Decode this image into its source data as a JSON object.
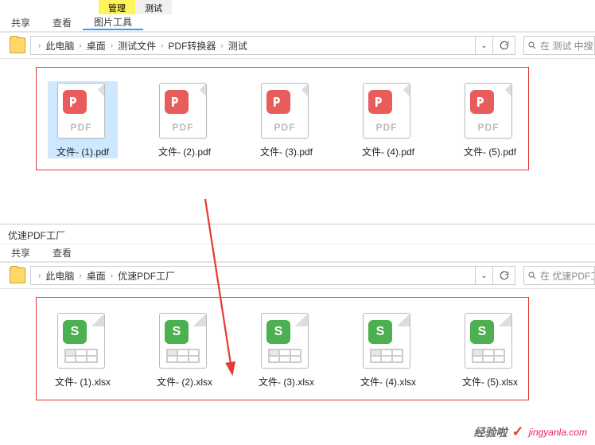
{
  "top": {
    "ribbon_label": "管理",
    "ribbon_context": "测试",
    "tabs": {
      "share": "共享",
      "view": "查看",
      "image_tools": "图片工具"
    },
    "breadcrumb": [
      "此电脑",
      "桌面",
      "测试文件",
      "PDF转换器",
      "测试"
    ],
    "search_placeholder": "在 测试 中搜",
    "files": [
      {
        "name": "文件- (1).pdf",
        "type": "pdf"
      },
      {
        "name": "文件- (2).pdf",
        "type": "pdf"
      },
      {
        "name": "文件- (3).pdf",
        "type": "pdf"
      },
      {
        "name": "文件- (4).pdf",
        "type": "pdf"
      },
      {
        "name": "文件- (5).pdf",
        "type": "pdf"
      }
    ],
    "pdf_label": "PDF"
  },
  "bottom": {
    "title": "优速PDF工厂",
    "tabs": {
      "share": "共享",
      "view": "查看"
    },
    "breadcrumb": [
      "此电脑",
      "桌面",
      "优速PDF工厂"
    ],
    "search_placeholder": "在 优速PDF工",
    "files": [
      {
        "name": "文件- (1).xlsx",
        "type": "xlsx"
      },
      {
        "name": "文件- (2).xlsx",
        "type": "xlsx"
      },
      {
        "name": "文件- (3).xlsx",
        "type": "xlsx"
      },
      {
        "name": "文件- (4).xlsx",
        "type": "xlsx"
      },
      {
        "name": "文件- (5).xlsx",
        "type": "xlsx"
      }
    ],
    "xlsx_label": "S"
  },
  "watermark": {
    "text": "经验啦",
    "url": "jingyanla.com"
  }
}
